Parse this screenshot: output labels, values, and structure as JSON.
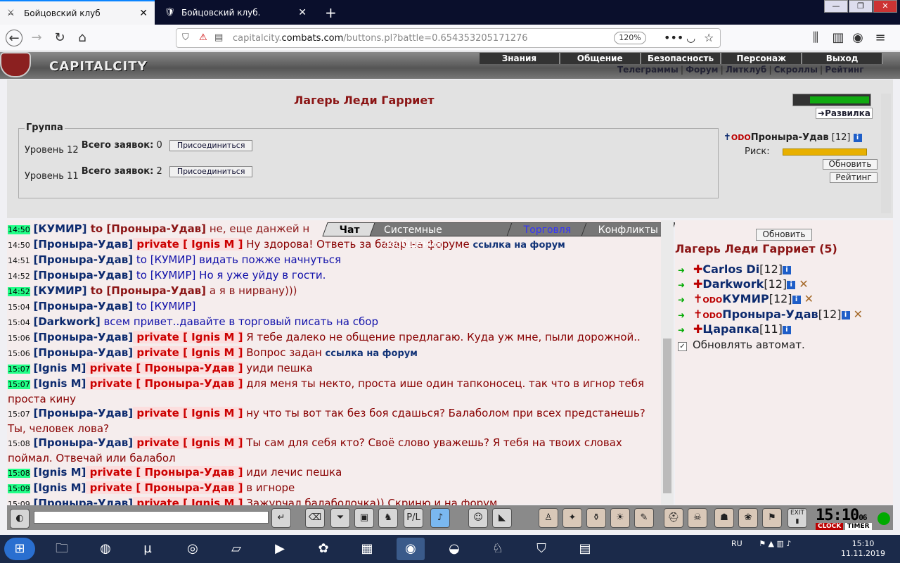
{
  "browser": {
    "tabs": [
      {
        "title": "Бойцовский клуб"
      },
      {
        "title": "Бойцовский клуб."
      }
    ],
    "new_tab": "+",
    "url_prefix": "capitalcity.",
    "url_domain": "combats.com",
    "url_path": "/buttons.pl?battle=0.654353205171276",
    "zoom": "120%"
  },
  "game": {
    "logo": "CAPITALCITY",
    "top_menu": [
      "Знания",
      "Общение",
      "Безопасность",
      "Персонаж",
      "Выход"
    ],
    "sub_menu": [
      "Телеграммы",
      "Форум",
      "Литклуб",
      "Скроллы",
      "Рейтинг"
    ],
    "camp_title": "Лагерь Леди Гарриет",
    "group_label": "Группа",
    "levels": [
      {
        "level": "Уровень 12",
        "label": "Всего заявок:",
        "count": "0",
        "join": "Присоединиться"
      },
      {
        "level": "Уровень 11",
        "label": "Всего заявок:",
        "count": "2",
        "join": "Присоединиться"
      }
    ],
    "razvilka": "Развилка",
    "player": {
      "clan": "ODO",
      "name": "Проныра-Удав",
      "level": "[12]",
      "risk_label": "Риск:",
      "risk": 1.0
    },
    "refresh": "Обновить",
    "rating": "Рейтинг",
    "chat_tabs": [
      "Чат",
      "Системные сообщения",
      "Торговля",
      "Конфликты"
    ],
    "chat": [
      {
        "t": "14:50",
        "hl": true,
        "parts": [
          [
            "n",
            "[КУМИР]"
          ],
          [
            "to",
            " to [Проныра-Удав]"
          ],
          [
            "tn",
            " не, еще данжей н"
          ]
        ]
      },
      {
        "t": "14:50",
        "hl": false,
        "parts": [
          [
            "n",
            "[Проныра-Удав]"
          ],
          [
            "p",
            " private [ Ignis M ]"
          ],
          [
            "x",
            " Ну здорова! Ответь за базар на форуме "
          ],
          [
            "l",
            "ссылка на форум"
          ]
        ]
      },
      {
        "t": "14:51",
        "hl": false,
        "parts": [
          [
            "n",
            "[Проныра-Удав]"
          ],
          [
            "tb",
            " to [КУМИР] видать пожже начнуться"
          ]
        ]
      },
      {
        "t": "14:52",
        "hl": false,
        "parts": [
          [
            "n",
            "[Проныра-Удав]"
          ],
          [
            "tb",
            " to [КУМИР] Но я уже уйду в гости."
          ]
        ]
      },
      {
        "t": "14:52",
        "hl": true,
        "parts": [
          [
            "n",
            "[КУМИР]"
          ],
          [
            "to",
            " to [Проныра-Удав]"
          ],
          [
            "tn",
            " а я в нирвану)))"
          ]
        ]
      },
      {
        "t": "15:04",
        "hl": false,
        "parts": [
          [
            "n",
            "[Проныра-Удав]"
          ],
          [
            "tb",
            " to [КУМИР]"
          ]
        ]
      },
      {
        "t": "15:04",
        "hl": false,
        "parts": [
          [
            "n",
            "[Darkwork]"
          ],
          [
            "tb",
            " всем привет..давайте в торговый писать на сбор"
          ]
        ]
      },
      {
        "t": "15:06",
        "hl": false,
        "parts": [
          [
            "n",
            "[Проныра-Удав]"
          ],
          [
            "p",
            " private [ Ignis M ]"
          ],
          [
            "x",
            " Я тебе далеко не общение предлагаю. Куда уж мне, пыли дорожной.."
          ]
        ]
      },
      {
        "t": "15:06",
        "hl": false,
        "parts": [
          [
            "n",
            "[Проныра-Удав]"
          ],
          [
            "p",
            " private [ Ignis M ]"
          ],
          [
            "x",
            " Вопрос задан "
          ],
          [
            "l",
            "ссылка на форум"
          ]
        ]
      },
      {
        "t": "15:07",
        "hl": true,
        "parts": [
          [
            "n",
            "[Ignis M]"
          ],
          [
            "p",
            " private [ Проныра-Удав ]"
          ],
          [
            "x",
            " уиди пешка"
          ]
        ]
      },
      {
        "t": "15:07",
        "hl": true,
        "parts": [
          [
            "n",
            "[Ignis M]"
          ],
          [
            "p",
            " private [ Проныра-Удав ]"
          ],
          [
            "x",
            " для меня ты некто, проста ише один тапконосец. так что в игнор тебя проста кину"
          ]
        ]
      },
      {
        "t": "15:07",
        "hl": false,
        "parts": [
          [
            "n",
            "[Проныра-Удав]"
          ],
          [
            "p",
            " private [ Ignis M ]"
          ],
          [
            "x",
            " ну что ты вот так без боя сдашься? Балаболом при всех предстанешь? Ты, человек лова?"
          ]
        ]
      },
      {
        "t": "15:08",
        "hl": false,
        "parts": [
          [
            "n",
            "[Проныра-Удав]"
          ],
          [
            "p",
            " private [ Ignis M ]"
          ],
          [
            "x",
            " Ты сам для себя кто? Своё слово уважешь? Я тебя на твоих словах поймал. Отвечай или балабол"
          ]
        ]
      },
      {
        "t": "15:08",
        "hl": true,
        "parts": [
          [
            "n",
            "[Ignis M]"
          ],
          [
            "p",
            " private [ Проныра-Удав ]"
          ],
          [
            "x",
            " иди лечис пешка"
          ]
        ]
      },
      {
        "t": "15:09",
        "hl": true,
        "parts": [
          [
            "n",
            "[Ignis M]"
          ],
          [
            "p",
            " private [ Проныра-Удав ]"
          ],
          [
            "x",
            " в игноре"
          ]
        ]
      },
      {
        "t": "15:09",
        "hl": false,
        "parts": [
          [
            "n",
            "[Проныра-Удав]"
          ],
          [
            "p",
            " private [ Ignis M ]"
          ],
          [
            "x",
            " Зажурчал балаболочка)) Скриню и на форум."
          ]
        ]
      }
    ],
    "side": {
      "refresh": "Обновить",
      "title": "Лагерь Леди Гарриет (5)",
      "members": [
        {
          "clan": "",
          "name": "Carlos Di",
          "level": "[12]",
          "sword": false
        },
        {
          "clan": "",
          "name": "Darkwork",
          "level": "[12]",
          "sword": true
        },
        {
          "clan": "ODO",
          "name": "КУМИР",
          "level": "[12]",
          "sword": true
        },
        {
          "clan": "ODO",
          "name": "Проныра-Удав",
          "level": "[12]",
          "sword": true
        },
        {
          "clan": "",
          "name": "Царапка",
          "level": "[11]",
          "sword": false
        }
      ],
      "auto_refresh": "Обновлять автомат."
    },
    "clock": "15:10",
    "clock_sec": "06",
    "clock_label": "CLOCK",
    "timer_label": "TIMER",
    "exit_label": "EXIT"
  },
  "taskbar": {
    "lang": "RU",
    "time": "15:10",
    "date": "11.11.2019"
  }
}
